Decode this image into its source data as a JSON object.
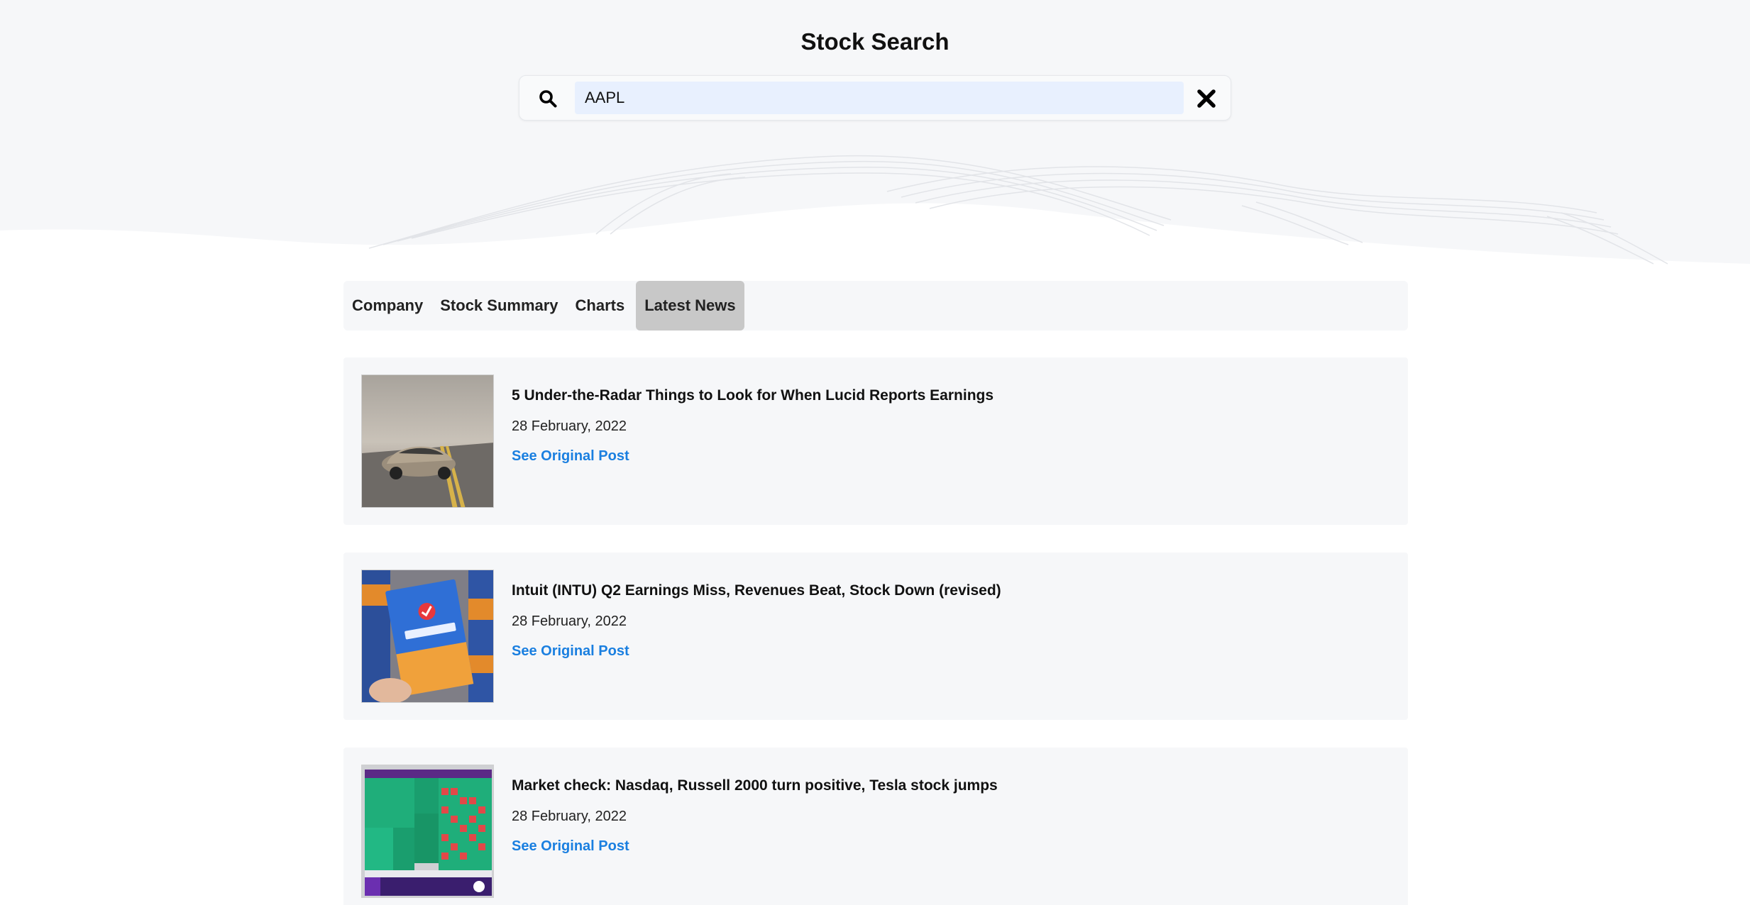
{
  "header": {
    "title": "Stock Search"
  },
  "search": {
    "value": "AAPL",
    "search_icon": "search-icon",
    "clear_icon": "close-icon"
  },
  "tabs": [
    {
      "label": "Company",
      "active": false
    },
    {
      "label": "Stock Summary",
      "active": false
    },
    {
      "label": "Charts",
      "active": false
    },
    {
      "label": "Latest News",
      "active": true
    }
  ],
  "news": [
    {
      "title": "5 Under-the-Radar Things to Look for When Lucid Reports Earnings",
      "date": "28 February, 2022",
      "link_label": "See Original Post"
    },
    {
      "title": "Intuit (INTU) Q2 Earnings Miss, Revenues Beat, Stock Down (revised)",
      "date": "28 February, 2022",
      "link_label": "See Original Post"
    },
    {
      "title": "Market check: Nasdaq, Russell 2000 turn positive, Tesla stock jumps",
      "date": "28 February, 2022",
      "link_label": "See Original Post"
    }
  ],
  "colors": {
    "link": "#1a7fe0",
    "active_tab": "#c8c8c8",
    "card_bg": "#f6f7f9",
    "search_input_bg": "#e8f0fe"
  }
}
